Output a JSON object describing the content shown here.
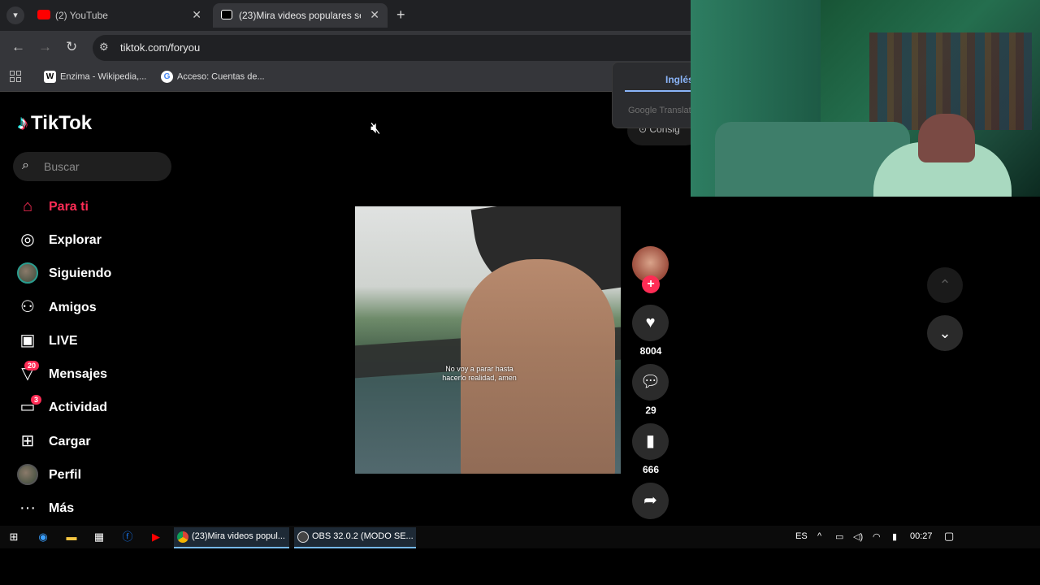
{
  "browser": {
    "tabs": [
      {
        "label": "(2) YouTube",
        "close": "✕"
      },
      {
        "label": "(23)Mira videos populares selec",
        "close": "✕"
      }
    ],
    "new_tab": "+",
    "url": "tiktok.com/foryou",
    "bookmarks": [
      {
        "label": "Enzima - Wikipedia,...",
        "icon": "W"
      },
      {
        "label": "Acceso: Cuentas de...",
        "icon": "G"
      }
    ]
  },
  "translate_popup": {
    "language": "Inglés",
    "provider": "Google Translat",
    "consig": "Consig"
  },
  "tiktok": {
    "logo": "TikTok",
    "search_placeholder": "Buscar",
    "nav": [
      {
        "label": "Para ti",
        "icon": "home-icon"
      },
      {
        "label": "Explorar",
        "icon": "compass-icon"
      },
      {
        "label": "Siguiendo",
        "icon": "following-avatar-icon"
      },
      {
        "label": "Amigos",
        "icon": "friends-icon"
      },
      {
        "label": "LIVE",
        "icon": "live-icon"
      },
      {
        "label": "Mensajes",
        "icon": "messages-icon",
        "badge": "20"
      },
      {
        "label": "Actividad",
        "icon": "activity-icon",
        "badge": "3"
      },
      {
        "label": "Cargar",
        "icon": "upload-icon"
      },
      {
        "label": "Perfil",
        "icon": "profile-avatar-icon"
      },
      {
        "label": "Más",
        "icon": "more-icon"
      }
    ],
    "video": {
      "caption_line1": "No voy a parar hasta",
      "caption_line2": "hacerlo realidad, amen"
    },
    "actions": {
      "likes": "8004",
      "comments": "29",
      "saves": "666"
    }
  },
  "taskbar": {
    "apps": [
      {
        "label": "(23)Mira videos popul..."
      },
      {
        "label": "OBS 32.0.2 (MODO SE..."
      }
    ],
    "lang": "ES",
    "time": "00:27"
  },
  "colors": {
    "accent": "#fe2c55",
    "background": "#000000",
    "chrome_dark": "#202124",
    "chrome_mid": "#35363a"
  }
}
